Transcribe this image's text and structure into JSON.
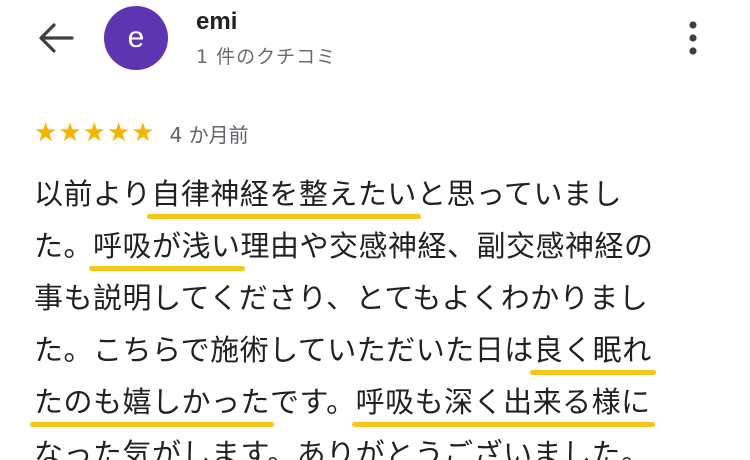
{
  "header": {
    "back_icon": "arrow-left-icon",
    "avatar": {
      "letter": "e",
      "color": "#5e35b1"
    },
    "user_name": "emi",
    "review_count": "1 件のクチコミ",
    "more_icon": "more-vert-icon"
  },
  "rating": {
    "stars": 5,
    "star_icon": "star-icon",
    "star_color": "#f5b400",
    "date": "4 か月前"
  },
  "review": {
    "highlight_color": "#f5c518",
    "lines": [
      [
        {
          "t": "以前より",
          "h": false
        },
        {
          "t": "自律神経を整えたい",
          "h": true
        },
        {
          "t": "と思っていまし",
          "h": false
        }
      ],
      [
        {
          "t": "た。",
          "h": false
        },
        {
          "t": "呼吸が浅い",
          "h": true
        },
        {
          "t": "理由や交感神経、副交感神経の",
          "h": false
        }
      ],
      [
        {
          "t": "事も説明してくださり、とてもよくわかりまし",
          "h": false
        }
      ],
      [
        {
          "t": "た。こちらで施術していただいた日は",
          "h": false
        },
        {
          "t": "良く眠れ",
          "h": true
        }
      ],
      [
        {
          "t": "たのも嬉しかった",
          "h": true
        },
        {
          "t": "です。",
          "h": false
        },
        {
          "t": "呼吸も深く出来る様に",
          "h": true
        }
      ],
      [
        {
          "t": "なった気がします。ありがとうございました。",
          "h": false
        }
      ]
    ]
  }
}
